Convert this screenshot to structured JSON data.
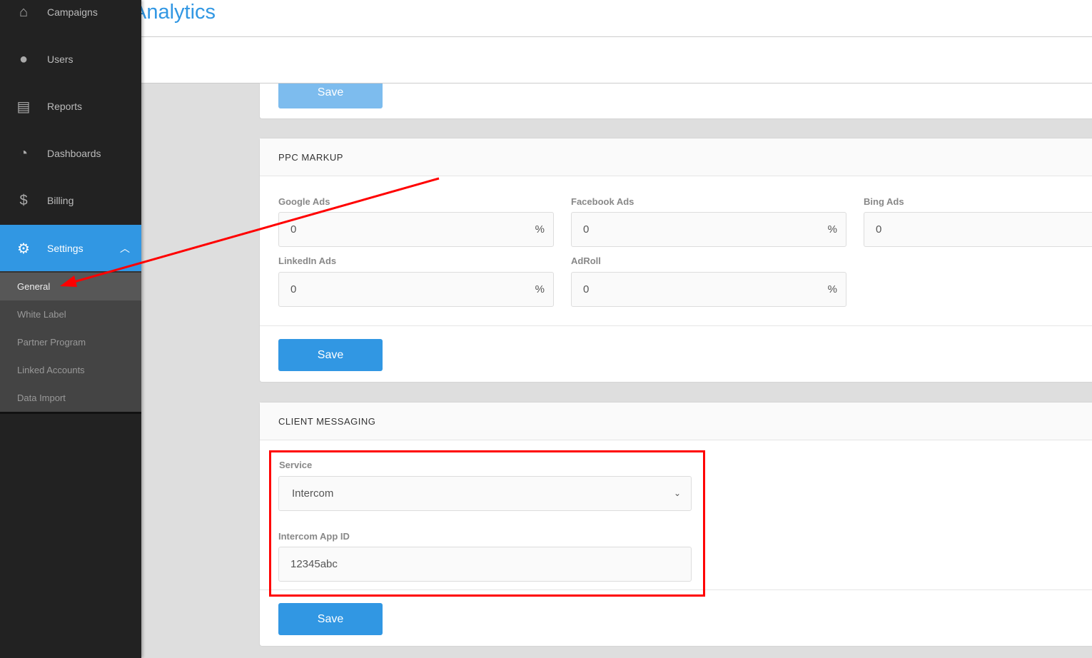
{
  "header": {
    "title": "Analytics"
  },
  "sidebar": {
    "items": [
      {
        "label": "Campaigns",
        "icon": "home-icon"
      },
      {
        "label": "Users",
        "icon": "user-icon"
      },
      {
        "label": "Reports",
        "icon": "report-icon"
      },
      {
        "label": "Dashboards",
        "icon": "dashboard-icon"
      },
      {
        "label": "Billing",
        "icon": "dollar-icon"
      },
      {
        "label": "Settings",
        "icon": "gear-icon"
      }
    ],
    "submenu": [
      "General",
      "White Label",
      "Partner Program",
      "Linked Accounts",
      "Data Import"
    ]
  },
  "top_card": {
    "save": "Save"
  },
  "ppc": {
    "title": "PPC MARKUP",
    "fields": [
      {
        "label": "Google Ads",
        "value": "0",
        "unit": "%"
      },
      {
        "label": "Facebook Ads",
        "value": "0",
        "unit": "%"
      },
      {
        "label": "Bing Ads",
        "value": "0"
      },
      {
        "label": "LinkedIn Ads",
        "value": "0",
        "unit": "%"
      },
      {
        "label": "AdRoll",
        "value": "0",
        "unit": "%"
      }
    ],
    "save": "Save"
  },
  "messaging": {
    "title": "CLIENT MESSAGING",
    "service_label": "Service",
    "service_value": "Intercom",
    "appid_label": "Intercom App ID",
    "appid_value": "12345abc",
    "save": "Save"
  },
  "colors": {
    "accent": "#3197e3",
    "annotation": "#ff0000"
  }
}
